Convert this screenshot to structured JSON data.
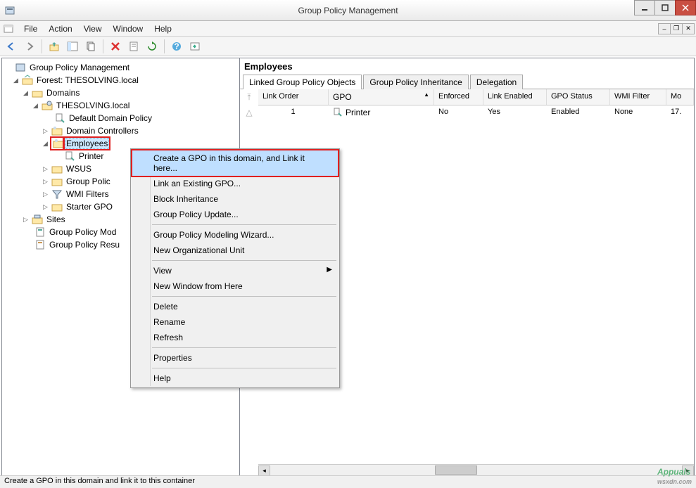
{
  "window": {
    "title": "Group Policy Management"
  },
  "menus": {
    "file": "File",
    "action": "Action",
    "view": "View",
    "window": "Window",
    "help": "Help"
  },
  "tree": {
    "root": "Group Policy Management",
    "forest": "Forest: THESOLVING.local",
    "domains": "Domains",
    "domain": "THESOLVING.local",
    "default_policy": "Default Domain Policy",
    "domain_controllers": "Domain Controllers",
    "employees": "Employees",
    "printer": "Printer",
    "wsus": "WSUS",
    "gpo": "Group Polic",
    "wmi": "WMI Filters",
    "starter": "Starter GPO",
    "sites": "Sites",
    "modeling": "Group Policy Mod",
    "results": "Group Policy Resu"
  },
  "right": {
    "title": "Employees",
    "tabs": {
      "linked": "Linked Group Policy Objects",
      "inh": "Group Policy Inheritance",
      "del": "Delegation"
    },
    "cols": {
      "order": "Link Order",
      "gpo": "GPO",
      "enf": "Enforced",
      "enabled": "Link Enabled",
      "status": "GPO Status",
      "wmi": "WMI Filter",
      "mod": "Mo"
    },
    "row": {
      "order": "1",
      "gpo": "Printer",
      "enf": "No",
      "enabled": "Yes",
      "status": "Enabled",
      "wmi": "None",
      "mod": "17."
    }
  },
  "context": {
    "create": "Create a GPO in this domain, and Link it here...",
    "link": "Link an Existing GPO...",
    "block": "Block Inheritance",
    "update": "Group Policy Update...",
    "wizard": "Group Policy Modeling Wizard...",
    "newou": "New Organizational Unit",
    "view": "View",
    "newwin": "New Window from Here",
    "delete": "Delete",
    "rename": "Rename",
    "refresh": "Refresh",
    "props": "Properties",
    "help": "Help"
  },
  "status": "Create a GPO in this domain and link it to this container",
  "watermark": {
    "brand": "Appuals",
    "site": "wsxdn.com"
  }
}
